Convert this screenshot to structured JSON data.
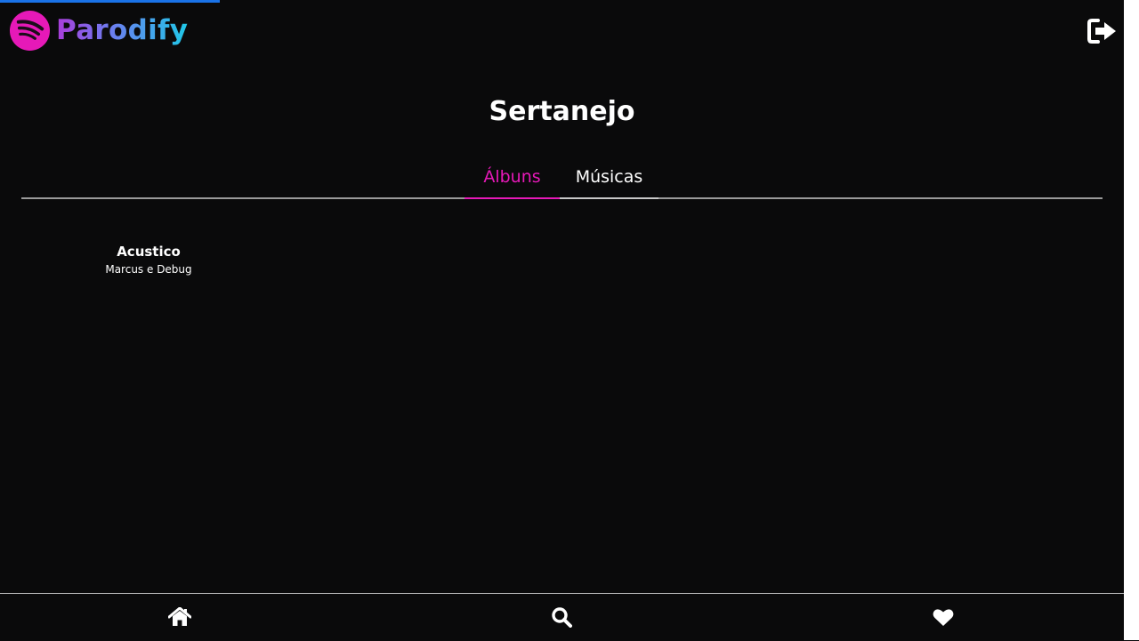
{
  "header": {
    "logo_text": "Parodify",
    "logout_icon": "sign-out-icon"
  },
  "page": {
    "title": "Sertanejo"
  },
  "tabs": [
    {
      "label": "Álbuns",
      "active": true
    },
    {
      "label": "Músicas",
      "active": false
    }
  ],
  "albums": [
    {
      "title": "Acustico",
      "artist": "Marcus e Debug"
    }
  ],
  "bottom_nav": [
    {
      "icon": "home-icon"
    },
    {
      "icon": "search-icon"
    },
    {
      "icon": "heart-icon"
    }
  ],
  "colors": {
    "background": "#0a0a0b",
    "accent": "#e619b8",
    "logo_gradient_start": "#a93cd9",
    "logo_gradient_end": "#1fc8e8",
    "progress": "#1a73e8"
  }
}
